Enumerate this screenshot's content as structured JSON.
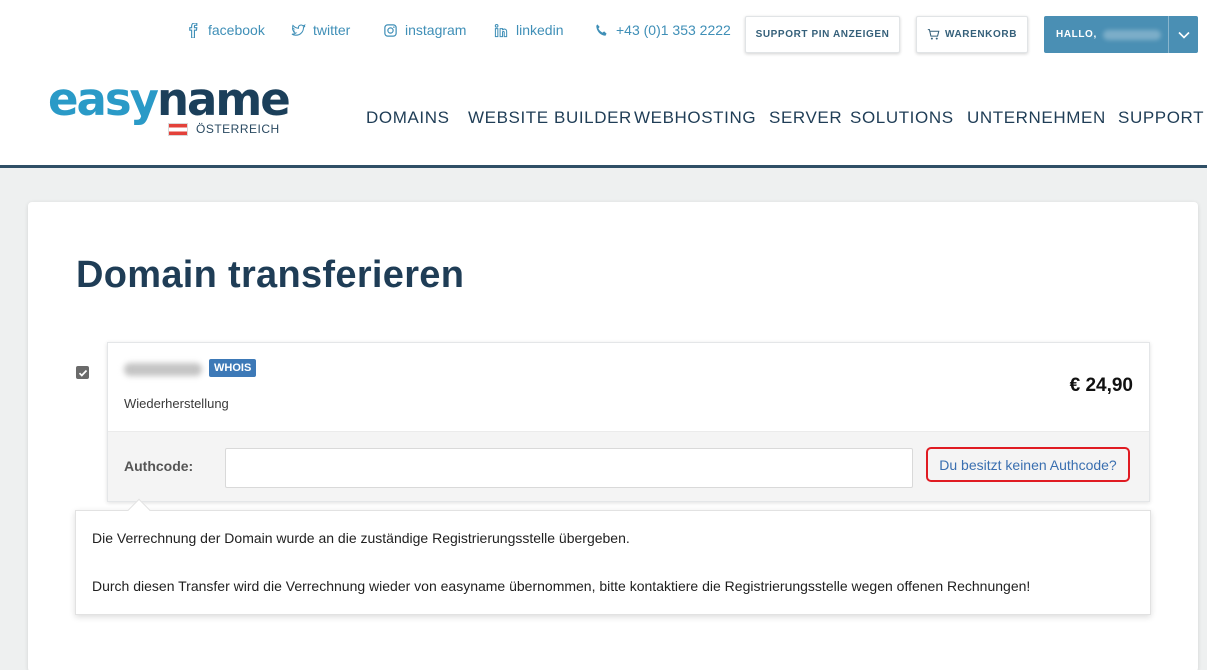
{
  "header": {
    "social": [
      {
        "label": "facebook",
        "icon": "facebook-icon"
      },
      {
        "label": "twitter",
        "icon": "twitter-icon"
      },
      {
        "label": "instagram",
        "icon": "instagram-icon"
      },
      {
        "label": "linkedin",
        "icon": "linkedin-icon"
      }
    ],
    "phone": {
      "label": "+43 (0)1 353 2222",
      "icon": "phone-icon"
    },
    "support_pin_label": "SUPPORT PIN ANZEIGEN",
    "cart_label": "WARENKORB",
    "user_greeting": "HALLO,",
    "logo": {
      "part1": "easy",
      "part2": "name"
    },
    "country": "ÖSTERREICH",
    "nav": [
      "DOMAINS",
      "WEBSITE BUILDER",
      "WEBHOSTING",
      "SERVER",
      "SOLUTIONS",
      "UNTERNEHMEN",
      "SUPPORT"
    ]
  },
  "main": {
    "title": "Domain transferieren",
    "item": {
      "checked": true,
      "whois_label": "WHOIS",
      "status": "Wiederherstellung",
      "price": "€ 24,90",
      "authcode_label": "Authcode:",
      "authcode_value": "",
      "no_authcode_link": "Du besitzt keinen Authcode?"
    },
    "tooltip": {
      "line1": "Die Verrechnung der Domain wurde an die zuständige Registrierungsstelle übergeben.",
      "line2": "Durch diesen Transfer wird die Verrechnung wieder von easyname übernommen, bitte kontaktiere die Registrierungsstelle wegen offenen Rechnungen!"
    }
  },
  "colors": {
    "accent": "#3f8fb7",
    "navy": "#1f3d56",
    "user_button": "#4a8fb4",
    "highlight": "#e01b22"
  }
}
